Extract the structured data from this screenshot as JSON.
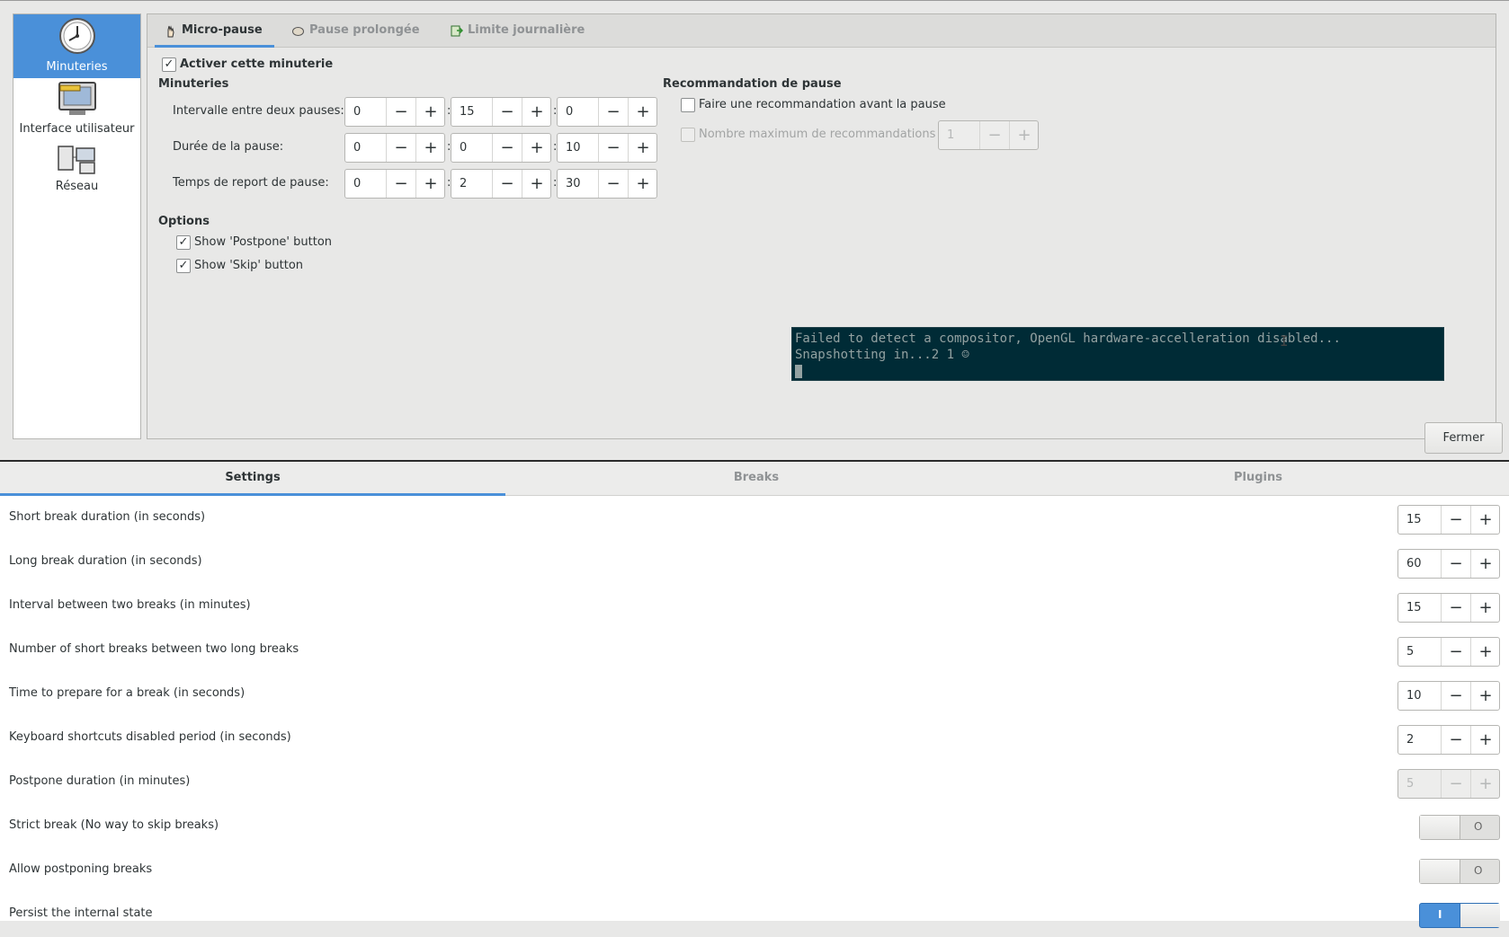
{
  "prefs": {
    "sidebar": {
      "items": [
        {
          "label": "Minuteries",
          "icon": "clock-icon",
          "selected": true
        },
        {
          "label": "Interface utilisateur",
          "icon": "monitor-icon",
          "selected": false
        },
        {
          "label": "Réseau",
          "icon": "network-icon",
          "selected": false
        }
      ]
    },
    "tabs": [
      {
        "label": "Micro-pause",
        "icon": "hand-icon",
        "active": true
      },
      {
        "label": "Pause prolongée",
        "icon": "bed-icon",
        "active": false
      },
      {
        "label": "Limite journalière",
        "icon": "exit-icon",
        "active": false
      }
    ],
    "enable_timer": {
      "label": "Activer cette minuterie",
      "checked": true
    },
    "timers": {
      "heading": "Minuteries",
      "rows": [
        {
          "label": "Intervalle entre deux pauses:",
          "h": "0",
          "m": "15",
          "s": "0"
        },
        {
          "label": "Durée de la pause:",
          "h": "0",
          "m": "0",
          "s": "10"
        },
        {
          "label": "Temps de report de pause:",
          "h": "0",
          "m": "2",
          "s": "30"
        }
      ],
      "separator": ":"
    },
    "recommendation": {
      "heading": "Recommandation de pause",
      "before_break": {
        "label": "Faire une recommandation avant la pause",
        "checked": false
      },
      "max_count": {
        "label": "Nombre maximum de recommandations",
        "value": "1",
        "checked": false,
        "enabled": false
      }
    },
    "options": {
      "heading": "Options",
      "show_postpone": {
        "label": "Show 'Postpone' button",
        "checked": true
      },
      "show_skip": {
        "label": "Show 'Skip' button",
        "checked": true
      }
    },
    "terminal": {
      "line1": "Failed to detect a compositor, OpenGL hardware-accelleration disabled...",
      "line2": "Snapshotting in...2 1 ☺"
    },
    "close_label": "Fermer",
    "spin_minus": "−",
    "spin_plus": "+"
  },
  "safeeyes": {
    "tabs": [
      {
        "label": "Settings",
        "active": true
      },
      {
        "label": "Breaks",
        "active": false
      },
      {
        "label": "Plugins",
        "active": false
      }
    ],
    "rows": [
      {
        "label": "Short break duration (in seconds)",
        "type": "spin",
        "value": "15",
        "enabled": true
      },
      {
        "label": "Long break duration (in seconds)",
        "type": "spin",
        "value": "60",
        "enabled": true
      },
      {
        "label": "Interval between two breaks (in minutes)",
        "type": "spin",
        "value": "15",
        "enabled": true
      },
      {
        "label": "Number of short breaks between two long breaks",
        "type": "spin",
        "value": "5",
        "enabled": true
      },
      {
        "label": "Time to prepare for a break (in seconds)",
        "type": "spin",
        "value": "10",
        "enabled": true
      },
      {
        "label": "Keyboard shortcuts disabled period (in seconds)",
        "type": "spin",
        "value": "2",
        "enabled": true
      },
      {
        "label": "Postpone duration (in minutes)",
        "type": "spin",
        "value": "5",
        "enabled": false
      },
      {
        "label": "Strict break (No way to skip breaks)",
        "type": "switch",
        "on": false,
        "state_text": "O"
      },
      {
        "label": "Allow postponing breaks",
        "type": "switch",
        "on": false,
        "state_text": "O"
      },
      {
        "label": "Persist the internal state",
        "type": "switch",
        "on": true,
        "state_text": "I"
      }
    ]
  },
  "colors": {
    "accent": "#4a90d9",
    "terminal_bg": "#002b36",
    "terminal_fg": "#93a1a1"
  }
}
